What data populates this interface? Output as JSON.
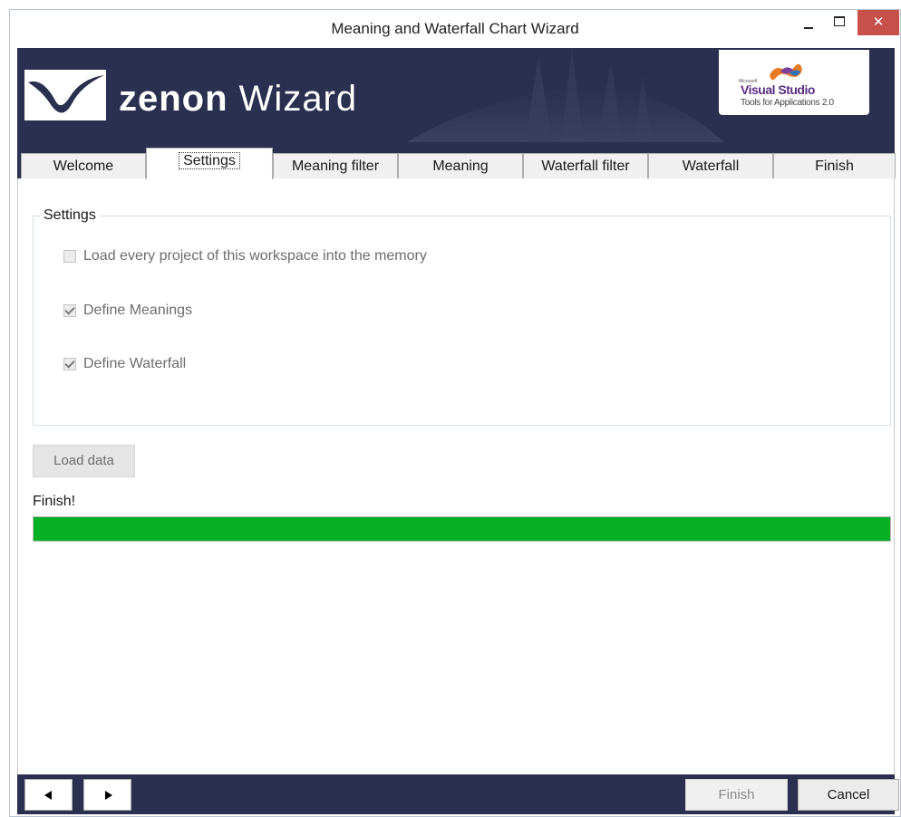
{
  "window": {
    "title": "Meaning and Waterfall Chart Wizard",
    "close_glyph": "✕",
    "minimize_icon": "minimize-icon",
    "maximize_icon": "maximize-icon"
  },
  "header": {
    "brand_bold": "zenon",
    "brand_light": "Wizard",
    "logo_icon": "zenon-logo-icon",
    "vs_badge": {
      "microsoft": "Microsoft",
      "name": "Visual Studio",
      "subtitle": "Tools for Applications 2.0"
    },
    "background_color": "#2b3050"
  },
  "tabs": [
    {
      "label": "Welcome",
      "active": false
    },
    {
      "label": "Settings",
      "active": true
    },
    {
      "label": "Meaning filter",
      "active": false
    },
    {
      "label": "Meaning",
      "active": false
    },
    {
      "label": "Waterfall filter",
      "active": false
    },
    {
      "label": "Waterfall",
      "active": false
    },
    {
      "label": "Finish",
      "active": false
    }
  ],
  "settings": {
    "group_title": "Settings",
    "options": [
      {
        "label": "Load every project of this workspace into the memory",
        "checked": false,
        "enabled": false
      },
      {
        "label": "Define Meanings",
        "checked": true,
        "enabled": false
      },
      {
        "label": "Define Waterfall",
        "checked": true,
        "enabled": false
      }
    ],
    "load_button": "Load data"
  },
  "status": {
    "label": "Finish!",
    "progress": 1.0,
    "progress_color": "#06b025"
  },
  "footer": {
    "back_icon": "arrow-left-icon",
    "next_icon": "arrow-right-icon",
    "finish_button": "Finish",
    "cancel_button": "Cancel"
  }
}
